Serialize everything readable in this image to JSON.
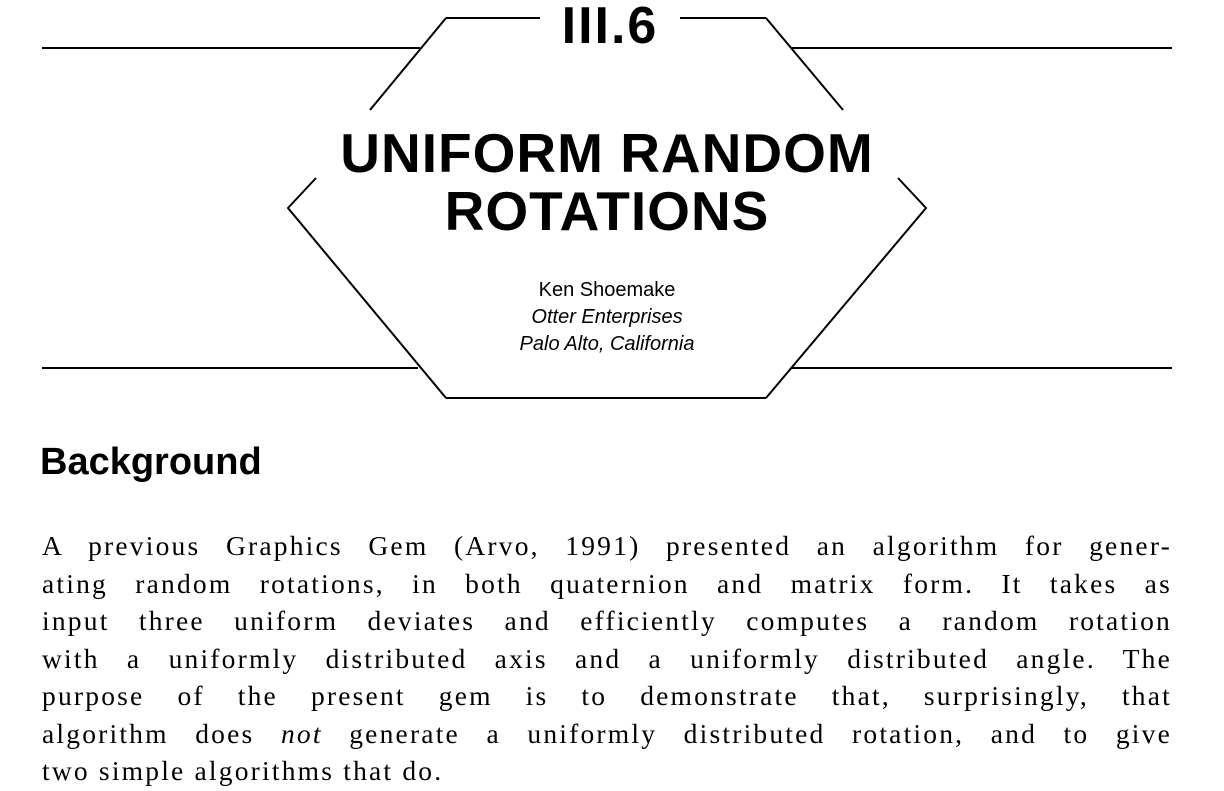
{
  "chapter": {
    "number": "III.6",
    "title_line_1": "UNIFORM RANDOM",
    "title_line_2": "ROTATIONS"
  },
  "author": {
    "name": "Ken Shoemake",
    "affiliation": "Otter Enterprises",
    "location": "Palo Alto, California"
  },
  "section": {
    "heading": "Background",
    "paragraph_lines": [
      "A previous Graphics Gem (Arvo, 1991) presented an algorithm for gener-",
      "ating random rotations, in both quaternion and matrix form. It takes as",
      "input three uniform deviates and efficiently computes a random rotation",
      "with a uniformly distributed axis and a uniformly distributed angle. The",
      "purpose of the present gem is to demonstrate that, surprisingly, that"
    ],
    "line_6_before": "algorithm does ",
    "line_6_emphasis": "not",
    "line_6_after": " generate a uniformly distributed rotation, and to give",
    "last_line": "two simple algorithms that do."
  }
}
